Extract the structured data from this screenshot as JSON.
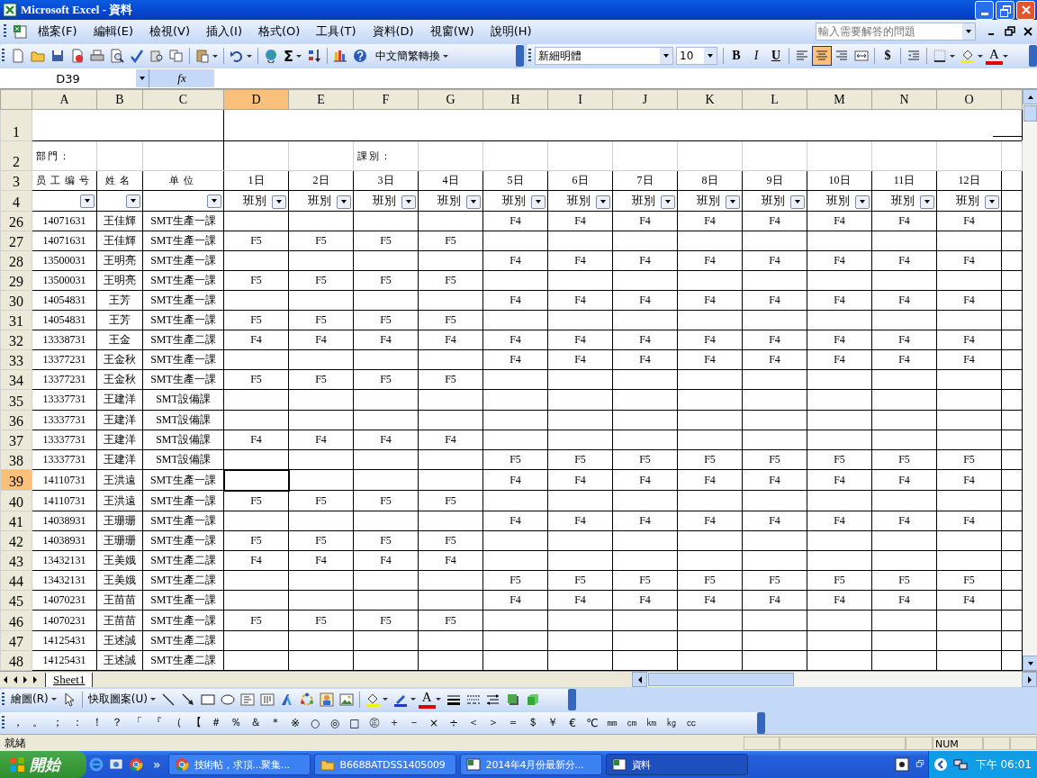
{
  "window": {
    "title": "Microsoft Excel - 資料"
  },
  "menu": [
    "檔案(F)",
    "編輯(E)",
    "檢視(V)",
    "插入(I)",
    "格式(O)",
    "工具(T)",
    "資料(D)",
    "視窗(W)",
    "說明(H)"
  ],
  "help_box": {
    "placeholder": "輸入需要解答的問題"
  },
  "standard_toolbar": {
    "sum": "Σ",
    "converter": "中文簡繁轉換"
  },
  "formatting_toolbar": {
    "font": "新細明體",
    "size": "10",
    "bold": "B",
    "italic": "I",
    "underline": "U",
    "align_buttons": [
      {
        "selected": false
      },
      {
        "selected": true
      },
      {
        "selected": false
      }
    ],
    "currency": "$",
    "font_color": "A"
  },
  "formula_bar": {
    "name_box": "D39",
    "fx": "fx"
  },
  "columns": [
    {
      "label": "A",
      "selected": false
    },
    {
      "label": "B",
      "selected": false
    },
    {
      "label": "C",
      "selected": false
    },
    {
      "label": "D",
      "selected": true
    },
    {
      "label": "E",
      "selected": false
    },
    {
      "label": "F",
      "selected": false
    },
    {
      "label": "G",
      "selected": false
    },
    {
      "label": "H",
      "selected": false
    },
    {
      "label": "I",
      "selected": false
    },
    {
      "label": "J",
      "selected": false
    },
    {
      "label": "K",
      "selected": false
    },
    {
      "label": "L",
      "selected": false
    },
    {
      "label": "M",
      "selected": false
    },
    {
      "label": "N",
      "selected": false
    },
    {
      "label": "O",
      "selected": false
    }
  ],
  "header_rows": [
    "1",
    "2",
    "3",
    "4"
  ],
  "sheet_header": {
    "dept_label": "部門：",
    "section_label": "課別：",
    "headings": [
      "员工编号",
      "姓名",
      "单位"
    ],
    "days": [
      {
        "day": "1日",
        "filter": "班別"
      },
      {
        "day": "2日",
        "filter": "班別"
      },
      {
        "day": "3日",
        "filter": "班別"
      },
      {
        "day": "4日",
        "filter": "班別"
      },
      {
        "day": "5日",
        "filter": "班別"
      },
      {
        "day": "6日",
        "filter": "班別"
      },
      {
        "day": "7日",
        "filter": "班別"
      },
      {
        "day": "8日",
        "filter": "班別"
      },
      {
        "day": "9日",
        "filter": "班別"
      },
      {
        "day": "10日",
        "filter": "班別"
      },
      {
        "day": "11日",
        "filter": "班別"
      },
      {
        "day": "12日",
        "filter": "班別"
      }
    ]
  },
  "rows": [
    {
      "number": "26",
      "selected": false,
      "id": "14071631",
      "name": "王佳輝",
      "unit": "SMT生產一課",
      "shifts_days_5_to_12": [
        "F4",
        "F4",
        "F4",
        "F4",
        "F4",
        "F4",
        "F4",
        "F4"
      ]
    },
    {
      "number": "27",
      "selected": false,
      "id": "14071631",
      "name": "王佳輝",
      "unit": "SMT生產一課",
      "shifts_days_1_to_4": [
        "F5",
        "F5",
        "F5",
        "F5"
      ]
    },
    {
      "number": "28",
      "selected": false,
      "id": "13500031",
      "name": "王明亮",
      "unit": "SMT生產一課",
      "shifts_days_5_to_12": [
        "F4",
        "F4",
        "F4",
        "F4",
        "F4",
        "F4",
        "F4",
        "F4"
      ]
    },
    {
      "number": "29",
      "selected": false,
      "id": "13500031",
      "name": "王明亮",
      "unit": "SMT生產一課",
      "shifts_days_1_to_4": [
        "F5",
        "F5",
        "F5",
        "F5"
      ]
    },
    {
      "number": "30",
      "selected": false,
      "id": "14054831",
      "name": "王芳",
      "unit": "SMT生產一課",
      "shifts_days_5_to_12": [
        "F4",
        "F4",
        "F4",
        "F4",
        "F4",
        "F4",
        "F4",
        "F4"
      ]
    },
    {
      "number": "31",
      "selected": false,
      "id": "14054831",
      "name": "王芳",
      "unit": "SMT生產一課",
      "shifts_days_1_to_4": [
        "F5",
        "F5",
        "F5",
        "F5"
      ]
    },
    {
      "number": "32",
      "selected": false,
      "id": "13338731",
      "name": "王金",
      "unit": "SMT生產二課",
      "shifts_days_1_to_4": [
        "F4",
        "F4",
        "F4",
        "F4"
      ],
      "shifts_days_5_to_12": [
        "F4",
        "F4",
        "F4",
        "F4",
        "F4",
        "F4",
        "F4",
        "F4"
      ]
    },
    {
      "number": "33",
      "selected": false,
      "id": "13377231",
      "name": "王金秋",
      "unit": "SMT生產一課",
      "shifts_days_5_to_12": [
        "F4",
        "F4",
        "F4",
        "F4",
        "F4",
        "F4",
        "F4",
        "F4"
      ]
    },
    {
      "number": "34",
      "selected": false,
      "id": "13377231",
      "name": "王金秋",
      "unit": "SMT生產一課",
      "shifts_days_1_to_4": [
        "F5",
        "F5",
        "F5",
        "F5"
      ]
    },
    {
      "number": "35",
      "selected": false,
      "id": "13337731",
      "name": "王建洋",
      "unit": "SMT設備課"
    },
    {
      "number": "36",
      "selected": false,
      "id": "13337731",
      "name": "王建洋",
      "unit": "SMT設備課"
    },
    {
      "number": "37",
      "selected": false,
      "id": "13337731",
      "name": "王建洋",
      "unit": "SMT設備課",
      "shifts_days_1_to_4": [
        "F4",
        "F4",
        "F4",
        "F4"
      ]
    },
    {
      "number": "38",
      "selected": false,
      "id": "13337731",
      "name": "王建洋",
      "unit": "SMT設備課",
      "shifts_days_5_to_12": [
        "F5",
        "F5",
        "F5",
        "F5",
        "F5",
        "F5",
        "F5",
        "F5"
      ]
    },
    {
      "number": "39",
      "selected": true,
      "id": "14110731",
      "name": "王洪遠",
      "unit": "SMT生產一課",
      "shifts_days_5_to_12": [
        "F4",
        "F4",
        "F4",
        "F4",
        "F4",
        "F4",
        "F4",
        "F4"
      ]
    },
    {
      "number": "40",
      "selected": false,
      "id": "14110731",
      "name": "王洪遠",
      "unit": "SMT生產一課",
      "shifts_days_1_to_4": [
        "F5",
        "F5",
        "F5",
        "F5"
      ]
    },
    {
      "number": "41",
      "selected": false,
      "id": "14038931",
      "name": "王珊珊",
      "unit": "SMT生產一課",
      "shifts_days_5_to_12": [
        "F4",
        "F4",
        "F4",
        "F4",
        "F4",
        "F4",
        "F4",
        "F4"
      ]
    },
    {
      "number": "42",
      "selected": false,
      "id": "14038931",
      "name": "王珊珊",
      "unit": "SMT生產一課",
      "shifts_days_1_to_4": [
        "F5",
        "F5",
        "F5",
        "F5"
      ]
    },
    {
      "number": "43",
      "selected": false,
      "id": "13432131",
      "name": "王美娥",
      "unit": "SMT生產二課",
      "shifts_days_1_to_4": [
        "F4",
        "F4",
        "F4",
        "F4"
      ]
    },
    {
      "number": "44",
      "selected": false,
      "id": "13432131",
      "name": "王美娥",
      "unit": "SMT生產二課",
      "shifts_days_5_to_12": [
        "F5",
        "F5",
        "F5",
        "F5",
        "F5",
        "F5",
        "F5",
        "F5"
      ]
    },
    {
      "number": "45",
      "selected": false,
      "id": "14070231",
      "name": "王苗苗",
      "unit": "SMT生產一課",
      "shifts_days_5_to_12": [
        "F4",
        "F4",
        "F4",
        "F4",
        "F4",
        "F4",
        "F4",
        "F4"
      ]
    },
    {
      "number": "46",
      "selected": false,
      "id": "14070231",
      "name": "王苗苗",
      "unit": "SMT生產一課",
      "shifts_days_1_to_4": [
        "F5",
        "F5",
        "F5",
        "F5"
      ]
    },
    {
      "number": "47",
      "selected": false,
      "id": "14125431",
      "name": "王述誠",
      "unit": "SMT生產二課"
    },
    {
      "number": "48",
      "selected": false,
      "id": "14125431",
      "name": "王述誠",
      "unit": "SMT生產二課"
    }
  ],
  "sheet_tabs": [
    {
      "label": "Sheet1",
      "selected": true
    }
  ],
  "drawing_toolbar": {
    "draw": "繪圖(R)",
    "autoshapes": "快取圖案(U)",
    "font_color": "A"
  },
  "symbols": [
    "，",
    "。",
    "；",
    "：",
    "！",
    "？",
    "「",
    "『",
    "（",
    "【",
    "＃",
    "％",
    "＆",
    "＊",
    "※",
    "○",
    "◎",
    "□",
    "㊣",
    "＋",
    "－",
    "×",
    "÷",
    "＜",
    "＞",
    "＝",
    "＄",
    "￥",
    "€",
    "℃",
    "㎜",
    "㎝",
    "㎞",
    "㎏",
    "㏄"
  ],
  "status_bar": {
    "status": "就緒",
    "num": "NUM"
  },
  "taskbar": {
    "start": "開始",
    "more": "»",
    "tasks": [
      {
        "label": "技術帖，求頂...聚集...",
        "kind": "browser",
        "selected": false
      },
      {
        "label": "B6688ATDSS1405009",
        "kind": "folder",
        "selected": false
      },
      {
        "label": "2014年4月份最新分...",
        "kind": "spreadsheet",
        "selected": false
      },
      {
        "label": "資料",
        "kind": "spreadsheet",
        "selected": true
      }
    ],
    "clock": "下午 06:01"
  }
}
